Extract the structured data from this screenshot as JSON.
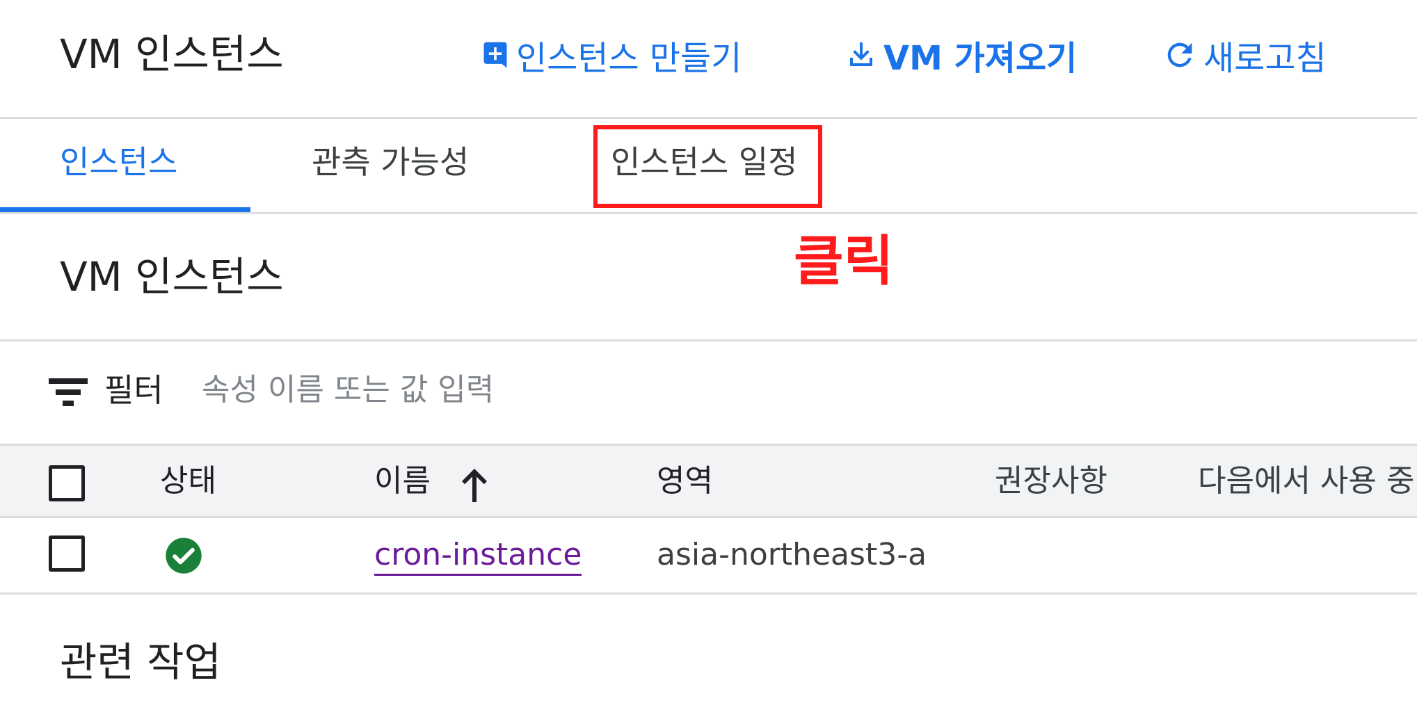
{
  "header": {
    "title": "VM 인스턴스",
    "actions": [
      {
        "label": "인스턴스 만들기",
        "icon": "add-box-icon"
      },
      {
        "label": "VM 가져오기",
        "icon": "download-icon"
      },
      {
        "label": "새로고침",
        "icon": "refresh-icon"
      }
    ]
  },
  "tabs": [
    {
      "label": "인스턴스",
      "active": true
    },
    {
      "label": "관측 가능성",
      "active": false
    },
    {
      "label": "인스턴스 일정",
      "active": false
    }
  ],
  "annotation": {
    "text": "클릭",
    "color": "#ff1b1b"
  },
  "section": {
    "title": "VM 인스턴스"
  },
  "filter": {
    "label": "필터",
    "placeholder": "속성 이름 또는 값 입력"
  },
  "table": {
    "columns": [
      "상태",
      "이름",
      "영역",
      "권장사항",
      "다음에서 사용 중"
    ],
    "sort_column": "이름",
    "sort_direction": "ascending",
    "rows": [
      {
        "status": "running",
        "name": "cron-instance",
        "zone": "asia-northeast3-a",
        "recommendation": "",
        "in_use_by": ""
      }
    ]
  },
  "related": {
    "title": "관련 작업"
  },
  "colors": {
    "accent": "#1a73e8",
    "status_ok": "#188038",
    "link": "#6a1b9a",
    "highlight": "#ff1b1b"
  }
}
